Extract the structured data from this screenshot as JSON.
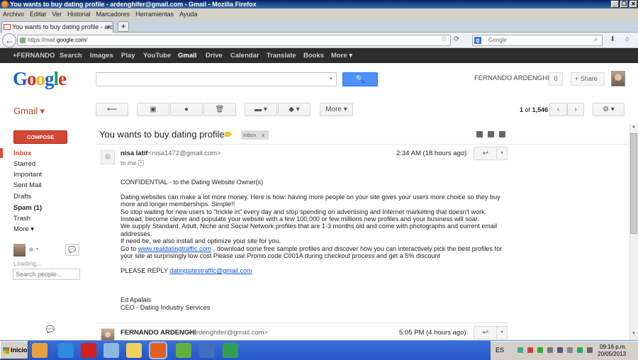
{
  "window": {
    "title": "You wants to buy dating profile - ardenghifer@gmail.com - Gmail - Mozilla Firefox",
    "min": "_",
    "restore": "❐",
    "close": "✕"
  },
  "menu": [
    "Archivo",
    "Editar",
    "Ver",
    "Historial",
    "Marcadores",
    "Herramientas",
    "Ayuda"
  ],
  "tab": {
    "title": "You wants to buy dating profile - ardenghife...",
    "close": "×",
    "new": "+"
  },
  "nav": {
    "back": "←",
    "url_prefix": "https://mail.",
    "url_domain": "google.com",
    "url_suffix": "/",
    "search_placeholder": "Google",
    "search_engine": "g"
  },
  "googlebar": [
    "+FERNANDO",
    "Search",
    "Images",
    "Play",
    "YouTube",
    "Gmail",
    "Drive",
    "Calendar",
    "Translate",
    "Books",
    "More ▾"
  ],
  "header": {
    "logo": [
      "G",
      "o",
      "o",
      "g",
      "l",
      "e"
    ],
    "search_button": "🔍",
    "user_name": "FERNANDO ARDENGHI",
    "notifications": "0",
    "share": "+ Share"
  },
  "toolbar": {
    "app_label": "Gmail ▾",
    "back": "⟵",
    "archive": "▣",
    "report_spam": "●",
    "delete": "🗑",
    "move_to": "▬ ▾",
    "labels": "◆ ▾",
    "more": "More ▾",
    "count_current": "1",
    "count_of": "of",
    "count_total": "1,546",
    "prev": "‹",
    "next": "›",
    "settings": "⚙ ▾"
  },
  "sidebar": {
    "compose": "COMPOSE",
    "items": [
      {
        "label": "Inbox"
      },
      {
        "label": "Starred"
      },
      {
        "label": "Important"
      },
      {
        "label": "Sent Mail"
      },
      {
        "label": "Drafts"
      },
      {
        "label": "Spam (1)"
      },
      {
        "label": "Trash"
      },
      {
        "label": "More ▾"
      }
    ],
    "chat_caret": "▾",
    "chat_button": "💬",
    "loading": "Loading...",
    "search_people_placeholder": "Search people...",
    "bottom_chat": "💬"
  },
  "thread": {
    "subject": "You wants to buy dating profile",
    "label": "Inbox",
    "label_close": "x"
  },
  "message1": {
    "sender_name": "nisa latif",
    "sender_email": "<nisa1472@gmail.com>",
    "time": "2:34 AM (18 hours ago)",
    "star": "☆",
    "reply": "↩",
    "reply_more": "▾",
    "to": "to me",
    "to_caret": "▾",
    "body": {
      "p1": "CONFIDENTIAL - to the Dating Website Owner(s)",
      "p2": "Dating websites can make a lot more money.  Here is how:  having more people on your site gives your users more choice so they buy more and longer memberships. Simple!!",
      "p3": "So stop waiting for new users to \"trickle in\" every day and stop spending on advertising and Internet marketing that doesn't work.",
      "p4": "Instead, become clever and populate your website with a few 100,000 or few millions new profiles and your business will soar.",
      "p5": "We supply Standard, Adult, Niche and Social Network profiles that are 1-3 months old and come with photographs and current email addresses.",
      "p6": "If need be, we also install and optimize your site for you.",
      "p7_before": "Go to ",
      "p7_link": "www.realdatingtraffic.com",
      "p7_after": " , download some free sample profiles and discover how you can interactively pick the best profiles for your site at surprisingly low cost Please use Promo code C001A during checkout process and get a 5% discount",
      "reply_label": "PLEASE REPLY  ",
      "reply_link": "datingsitestraffic@gmail.com",
      "sig1": "Ed Apalais",
      "sig2": "CEO - Dating Industry Services"
    }
  },
  "message2": {
    "sender_name": "FERNANDO ARDENGHI",
    "sender_email": "<ardenghifer@gmail.com>",
    "time": "5:05 PM (4 hours ago)",
    "star": "☆",
    "reply": "↩",
    "reply_more": "▾"
  },
  "taskbar": {
    "start": "Inicio",
    "lang": "ES",
    "time": "09:16 p.m.",
    "date": "20/05/2013",
    "icons": [
      {
        "name": "media-player-icon",
        "color": "#e8a040"
      },
      {
        "name": "internet-explorer-icon",
        "color": "#2f8be0"
      },
      {
        "name": "opera-icon",
        "color": "#d02020"
      },
      {
        "name": "notepad-icon",
        "color": "#8ab8e0"
      },
      {
        "name": "folder-icon",
        "color": "#f0d060"
      },
      {
        "name": "firefox-icon",
        "color": "#e06020"
      },
      {
        "name": "apps-icon",
        "color": "#60b040"
      },
      {
        "name": "files-icon",
        "color": "#4070c0"
      },
      {
        "name": "paint-icon",
        "color": "#30a050"
      }
    ]
  },
  "colors": {
    "gmail_red": "#d14836",
    "link_blue": "#1155cc",
    "google_bar": "#2d2d2d",
    "search_blue": "#4d90fe"
  }
}
